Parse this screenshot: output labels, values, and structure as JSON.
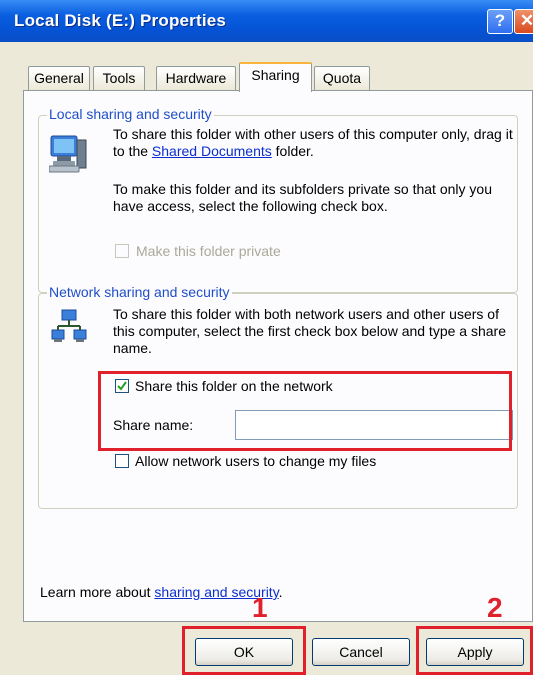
{
  "window": {
    "title": "Local Disk (E:) Properties",
    "help_glyph": "?",
    "close_glyph": "✕"
  },
  "tabs": [
    {
      "label": "General"
    },
    {
      "label": "Tools"
    },
    {
      "label": "Hardware"
    },
    {
      "label": "Sharing",
      "active": true
    },
    {
      "label": "Quota"
    }
  ],
  "local": {
    "group_label": "Local sharing and security",
    "para1_pre": "To share this folder with other users of this computer only, drag it to the ",
    "para1_link": "Shared Documents",
    "para1_post": " folder.",
    "para2": "To make this folder and its subfolders private so that only you have access, select the following check box.",
    "private_label": "Make this folder private",
    "private_checked": false,
    "private_enabled": false
  },
  "network": {
    "group_label": "Network sharing and security",
    "para": "To share this folder with both network users and other users of this computer, select the first check box below and type a share name.",
    "share_label": "Share this folder on the network",
    "share_checked": true,
    "share_name_label": "Share name:",
    "share_name_value": "",
    "allow_label": "Allow network users to change my files",
    "allow_checked": false
  },
  "learn_more": {
    "prefix": "Learn more about ",
    "link": "sharing and security",
    "suffix": "."
  },
  "buttons": {
    "ok": "OK",
    "cancel": "Cancel",
    "apply": "Apply"
  },
  "annotations": {
    "step1": "1",
    "step2": "2",
    "highlight_color": "#e0202a"
  }
}
